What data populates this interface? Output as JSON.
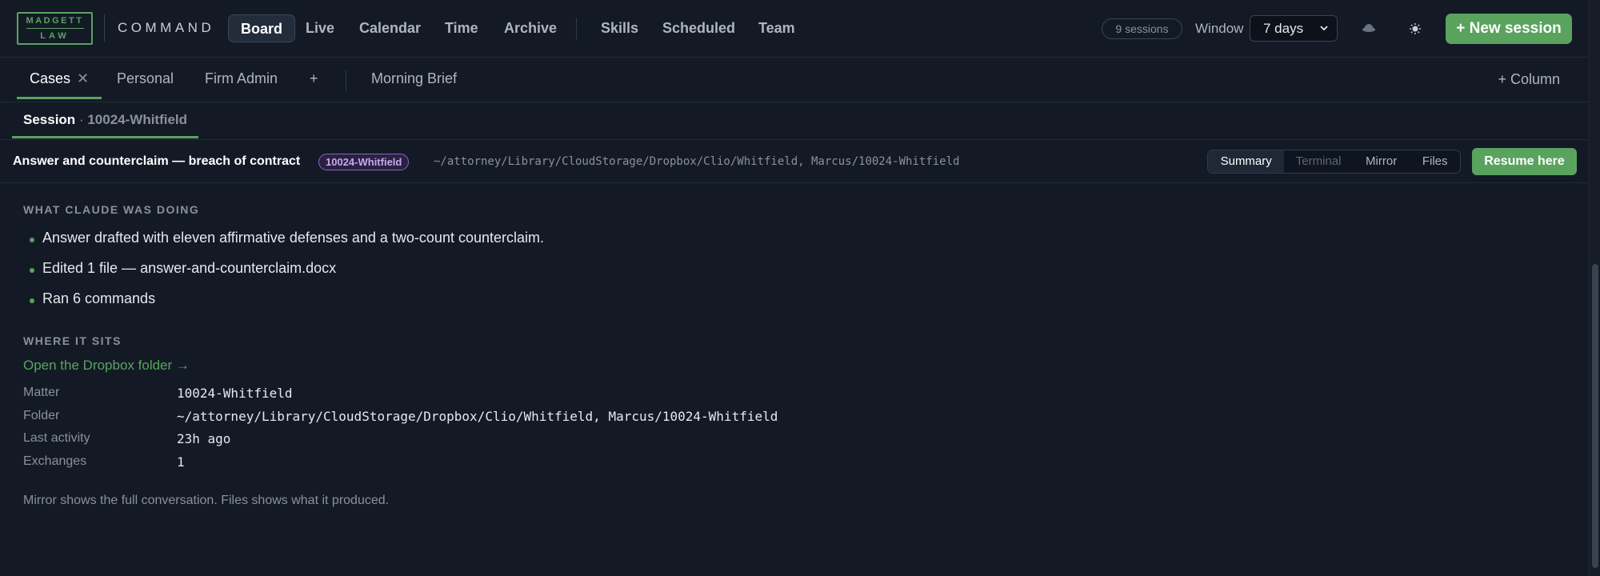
{
  "brand": {
    "logo_top": "MADGETT",
    "logo_bottom": "LAW",
    "name": "COMMAND"
  },
  "nav": {
    "items": [
      {
        "label": "Board",
        "active": true
      },
      {
        "label": "Live"
      },
      {
        "label": "Calendar"
      },
      {
        "label": "Time"
      },
      {
        "label": "Archive"
      },
      {
        "label": "Skills"
      },
      {
        "label": "Scheduled"
      },
      {
        "label": "Team"
      }
    ]
  },
  "topbar": {
    "sessions_count": "9 sessions",
    "window_label": "Window",
    "window_value": "7 days",
    "new_session_label": "+ New session",
    "incognito_icon": "incognito-icon",
    "theme_icon": "sun-icon"
  },
  "tabs": {
    "items": [
      {
        "label": "Cases",
        "active": true,
        "closable": true
      },
      {
        "label": "Personal"
      },
      {
        "label": "Firm Admin"
      },
      {
        "label": "+"
      },
      {
        "label": "Morning Brief"
      }
    ],
    "close_glyph": "✕",
    "add_column_label": "+ Column"
  },
  "session": {
    "label": "Session",
    "separator": "·",
    "id": "10024-Whitfield"
  },
  "case": {
    "title": "Answer and counterclaim — breach of contract",
    "badge": "10024-Whitfield",
    "path": "~/attorney/Library/CloudStorage/Dropbox/Clio/Whitfield, Marcus/10024-Whitfield",
    "views": [
      "Summary",
      "Terminal",
      "Mirror",
      "Files"
    ],
    "active_view": "Summary",
    "resume_label": "Resume here"
  },
  "summary": {
    "doing_heading": "WHAT CLAUDE WAS DOING",
    "bullets": [
      "Answer drafted with eleven affirmative defenses and a two-count counterclaim.",
      "Edited 1 file — answer-and-counterclaim.docx",
      "Ran 6 commands"
    ],
    "where_heading": "WHERE IT SITS",
    "folder_link": "Open the Dropbox folder →",
    "details": [
      {
        "label": "Matter",
        "value": "10024-Whitfield"
      },
      {
        "label": "Folder",
        "value": "~/attorney/Library/CloudStorage/Dropbox/Clio/Whitfield, Marcus/10024-Whitfield"
      },
      {
        "label": "Last activity",
        "value": "23h ago"
      },
      {
        "label": "Exchanges",
        "value": "1"
      }
    ],
    "footnote": "Mirror shows the full conversation. Files shows what it produced."
  },
  "colors": {
    "accent": "#5aa35f",
    "background": "#131a26",
    "badge": "#8a63c6"
  }
}
